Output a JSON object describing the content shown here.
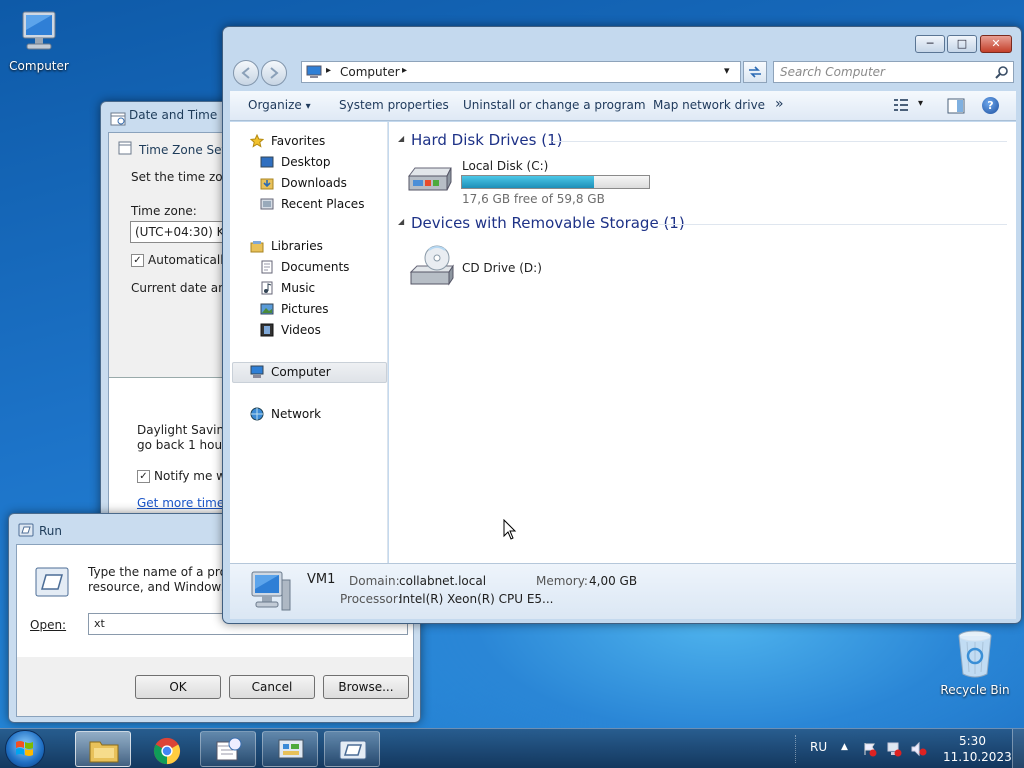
{
  "desktop": {
    "icons": [
      {
        "label": "Computer"
      },
      {
        "label": "Recycle Bin"
      }
    ]
  },
  "date_time": {
    "title": "Date and Time",
    "tz_settings_title": "Time Zone Setti",
    "set_text": "Set the time zone",
    "tz_label": "Time zone:",
    "tz_value": "(UTC+04:30) Kab",
    "auto_label": "Automatically",
    "current_text": "Current date and",
    "dst_line1": "Daylight Saving",
    "dst_line2": "go back 1 hour a",
    "notify_label": "Notify me wh",
    "more_link": "Get more time zo",
    "check_mark": "✓"
  },
  "run": {
    "title": "Run",
    "desc_line1": "Type the name of a program",
    "desc_line2": "resource, and Windows will",
    "open_label": "Open:",
    "open_value": "xt",
    "ok": "OK",
    "cancel": "Cancel",
    "browse": "Browse..."
  },
  "explorer": {
    "caption": {
      "minimize": "─",
      "maximize": "□",
      "close": "✕"
    },
    "address": {
      "separator": "▸",
      "crumb": "Computer",
      "arrow": "▸",
      "dropdown": "▾"
    },
    "search_placeholder": "Search Computer",
    "commands": {
      "organize": "Organize",
      "organize_arrow": "▾",
      "system_properties": "System properties",
      "uninstall": "Uninstall or change a program",
      "map_drive": "Map network drive",
      "more": "»",
      "view_arrow": "▾",
      "help": "?"
    },
    "nav": {
      "favorites": "Favorites",
      "desktop": "Desktop",
      "downloads": "Downloads",
      "recent": "Recent Places",
      "libraries": "Libraries",
      "documents": "Documents",
      "music": "Music",
      "pictures": "Pictures",
      "videos": "Videos",
      "computer": "Computer",
      "network": "Network"
    },
    "groups": {
      "hard_disks": "Hard Disk Drives (1)",
      "removable": "Devices with Removable Storage (1)",
      "expander": "◢"
    },
    "local_disk": {
      "name": "Local Disk (C:)",
      "free": "17,6 GB free of 59,8 GB",
      "used_fraction": 0.706
    },
    "cd_drive": {
      "name": "CD Drive (D:)"
    },
    "details": {
      "name": "VM1",
      "domain_label": "Domain:",
      "domain_value": "collabnet.local",
      "memory_label": "Memory:",
      "memory_value": "4,00 GB",
      "processor_label": "Processor:",
      "processor_value": "Intel(R) Xeon(R) CPU E5..."
    }
  },
  "taskbar": {
    "lang": "RU",
    "tray_arrow": "▲",
    "time": "5:30",
    "date": "11.10.2023"
  }
}
